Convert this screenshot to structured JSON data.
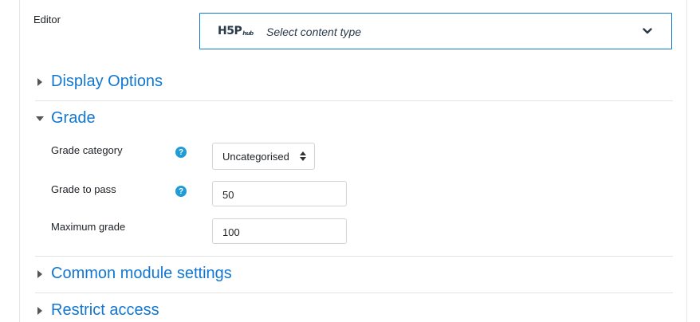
{
  "editor": {
    "label": "Editor",
    "logo": "H5P hub",
    "logo_main": "H5P",
    "logo_sub": "hub",
    "placeholder": "Select content type",
    "chevron_icon": "chevron-down-icon"
  },
  "sections": {
    "display_options": "Display Options",
    "grade": "Grade",
    "common_module_settings": "Common module settings",
    "restrict_access": "Restrict access"
  },
  "grade": {
    "category_label": "Grade category",
    "category_value": "Uncategorised",
    "to_pass_label": "Grade to pass",
    "to_pass_value": "50",
    "maximum_label": "Maximum grade",
    "maximum_value": "100",
    "help_glyph": "?"
  },
  "colors": {
    "link": "#1177d1",
    "help": "#1f9bd6"
  }
}
